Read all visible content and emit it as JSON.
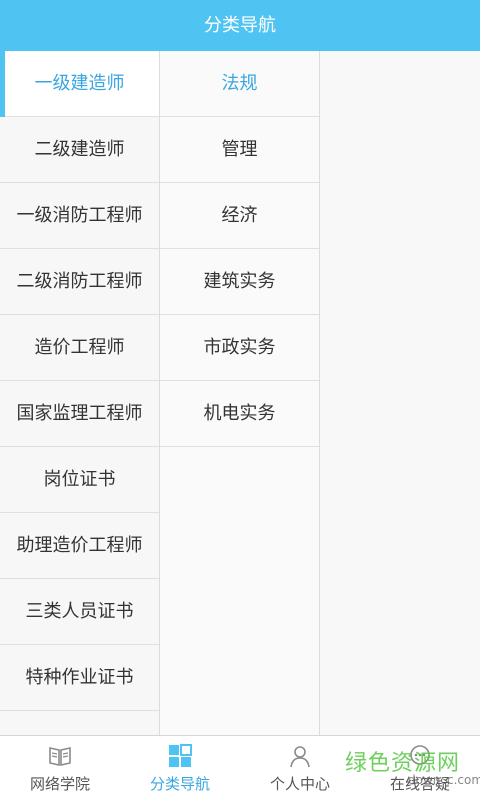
{
  "header": {
    "title": "分类导航"
  },
  "categories": [
    {
      "label": "一级建造师",
      "active": true
    },
    {
      "label": "二级建造师"
    },
    {
      "label": "一级消防工程师"
    },
    {
      "label": "二级消防工程师"
    },
    {
      "label": "造价工程师"
    },
    {
      "label": "国家监理工程师"
    },
    {
      "label": "岗位证书"
    },
    {
      "label": "助理造价工程师"
    },
    {
      "label": "三类人员证书"
    },
    {
      "label": "特种作业证书"
    }
  ],
  "subcategories": [
    {
      "label": "法规",
      "active": true
    },
    {
      "label": "管理"
    },
    {
      "label": "经济"
    },
    {
      "label": "建筑实务"
    },
    {
      "label": "市政实务"
    },
    {
      "label": "机电实务"
    }
  ],
  "bottom_nav": [
    {
      "label": "网络学院",
      "icon": "book-icon"
    },
    {
      "label": "分类导航",
      "icon": "grid-icon",
      "active": true
    },
    {
      "label": "个人中心",
      "icon": "person-icon"
    },
    {
      "label": "在线答疑",
      "icon": "chat-icon"
    }
  ],
  "watermark": {
    "text": "绿色资源网",
    "url": "downcc.com"
  },
  "colors": {
    "accent": "#4fc3f1",
    "active_text": "#3aa6e0",
    "watermark": "#5ecb4b"
  }
}
